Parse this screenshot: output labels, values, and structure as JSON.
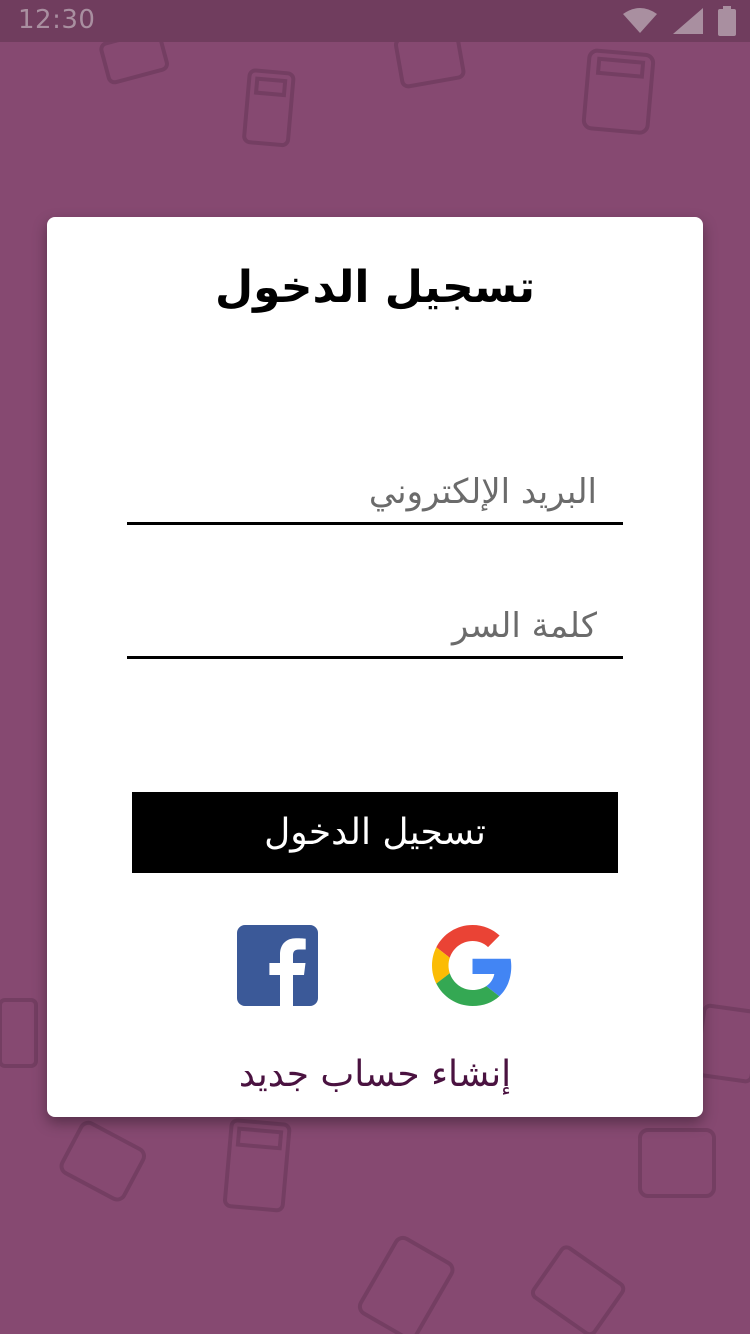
{
  "status_bar": {
    "time": "12:30",
    "icons": [
      "wifi-icon",
      "signal-icon",
      "battery-icon"
    ]
  },
  "login_card": {
    "title": "تسجيل الدخول",
    "email_placeholder": "البريد الإلكتروني",
    "password_placeholder": "كلمة السر",
    "login_button_label": "تسجيل الدخول",
    "social": [
      "facebook-icon",
      "google-icon"
    ],
    "create_account_label": "إنشاء حساب جديد"
  },
  "colors": {
    "background": "#864971",
    "status_bar": "#703d5e",
    "card": "#ffffff",
    "button": "#000000",
    "link": "#4a1240",
    "facebook": "#3b5998"
  }
}
